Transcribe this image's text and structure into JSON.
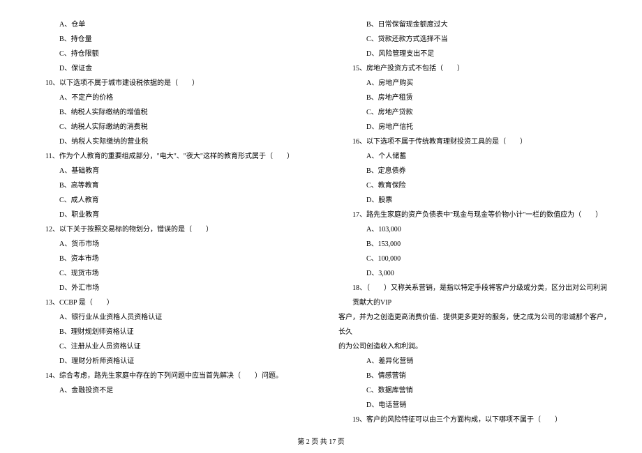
{
  "left_col": {
    "q9_options": [
      "A、仓单",
      "B、持仓量",
      "C、持仓限额",
      "D、保证金"
    ],
    "q10": "10、以下选项不属于城市建设税依据的是（　　）",
    "q10_options": [
      "A、不定产的价格",
      "B、纳税人实际缴纳的增值税",
      "C、纳税人实际缴纳的消费税",
      "D、纳税人实际缴纳的营业税"
    ],
    "q11": "11、作为个人教育的重要组成部分，\"电大\"、\"夜大\"这样的教育形式属于（　　）",
    "q11_options": [
      "A、基础教育",
      "B、高等教育",
      "C、成人教育",
      "D、职业教育"
    ],
    "q12": "12、以下关于按照交易标的物划分，错误的是（　　）",
    "q12_options": [
      "A、货币市场",
      "B、资本市场",
      "C、现货市场",
      "D、外汇市场"
    ],
    "q13": "13、CCBP 是（　　）",
    "q13_options": [
      "A、银行业从业资格人员资格认证",
      "B、理财规划师资格认证",
      "C、注册从业人员资格认证",
      "D、理财分析师资格认证"
    ],
    "q14": "14、综合考虑，路先生家庭中存在的下列问题中应当首先解决（　　）问题。",
    "q14_options": [
      "A、金融投资不足"
    ]
  },
  "right_col": {
    "q14_options_cont": [
      "B、日常保留现金额度过大",
      "C、贷款还款方式选择不当",
      "D、风险管理支出不足"
    ],
    "q15": "15、房地产投资方式不包括（　　）",
    "q15_options": [
      "A、房地产购买",
      "B、房地产租赁",
      "C、房地产贷款",
      "D、房地产信托"
    ],
    "q16": "16、以下选项不属于传统教育理财投资工具的是（　　）",
    "q16_options": [
      "A、个人储蓄",
      "B、定息债券",
      "C、教育保险",
      "D、股票"
    ],
    "q17": "17、路先生家庭的资产负债表中\"现金与现金等价物小计\"一栏的数值应为（　　）",
    "q17_options": [
      "A、103,000",
      "B、153,000",
      "C、100,000",
      "D、3,000"
    ],
    "q18_line1": "18、（　　）又称关系营销，是指以特定手段将客户分级或分类，区分出对公司利润贡献大的VIP",
    "q18_line2": "客户，并为之创造更高消费价值、提供更多更好的服务，使之成为公司的忠诚那个客户，长久",
    "q18_line3": "的为公司创造收入和利润。",
    "q18_options": [
      "A、差异化营销",
      "B、情感营销",
      "C、数据库营销",
      "D、电话营销"
    ],
    "q19": "19、客户的风险特征可以由三个方面构成，以下哪项不属于（　　）"
  },
  "footer": "第 2 页 共 17 页"
}
